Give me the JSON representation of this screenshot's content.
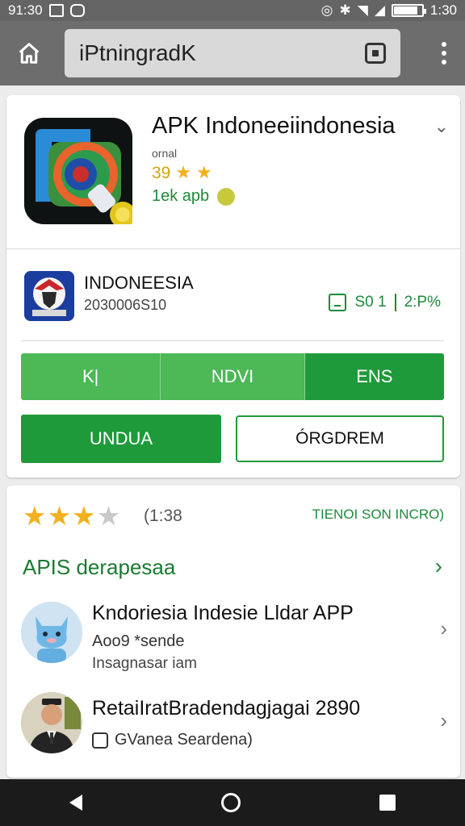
{
  "status_bar": {
    "time_left": "91:30",
    "time_right": "1:30",
    "battery_level": 0.85
  },
  "toolbar": {
    "url": "iPtningradK",
    "icons": [
      "home-icon",
      "tab-switcher-icon",
      "overflow-menu-icon"
    ]
  },
  "app": {
    "title": "APK Indoneeiindonesia",
    "subtitle": "ornal",
    "rating": "39",
    "size": "1ek apb"
  },
  "developer": {
    "name": "INDONEESIA",
    "id": "2030006S10",
    "meta_left": "S0 1",
    "meta_right": "2:P%"
  },
  "tabs": [
    {
      "label": "K|"
    },
    {
      "label": "NDVI"
    },
    {
      "label": "ENS"
    }
  ],
  "actions": {
    "primary": "UNDUA",
    "secondary": "ÓRGDREM"
  },
  "ratings": {
    "value": 3.5,
    "count": "(1:38",
    "link": "TIENOI SON INCRO)"
  },
  "section": {
    "title": "APIS derapesaa"
  },
  "list": [
    {
      "title": "Kndoriesia Indesie Lldar APP",
      "line1": "Aoo9 *sende",
      "line2": "Insagnasar iam"
    },
    {
      "title": "RetaiIratBradendagjagai 2890",
      "line1": "GVanea Seardena)"
    }
  ],
  "colors": {
    "accent_green": "#1e9a3a",
    "light_green": "#4cb856",
    "star": "#f2b01e",
    "toolbar": "#6d6d6d"
  }
}
